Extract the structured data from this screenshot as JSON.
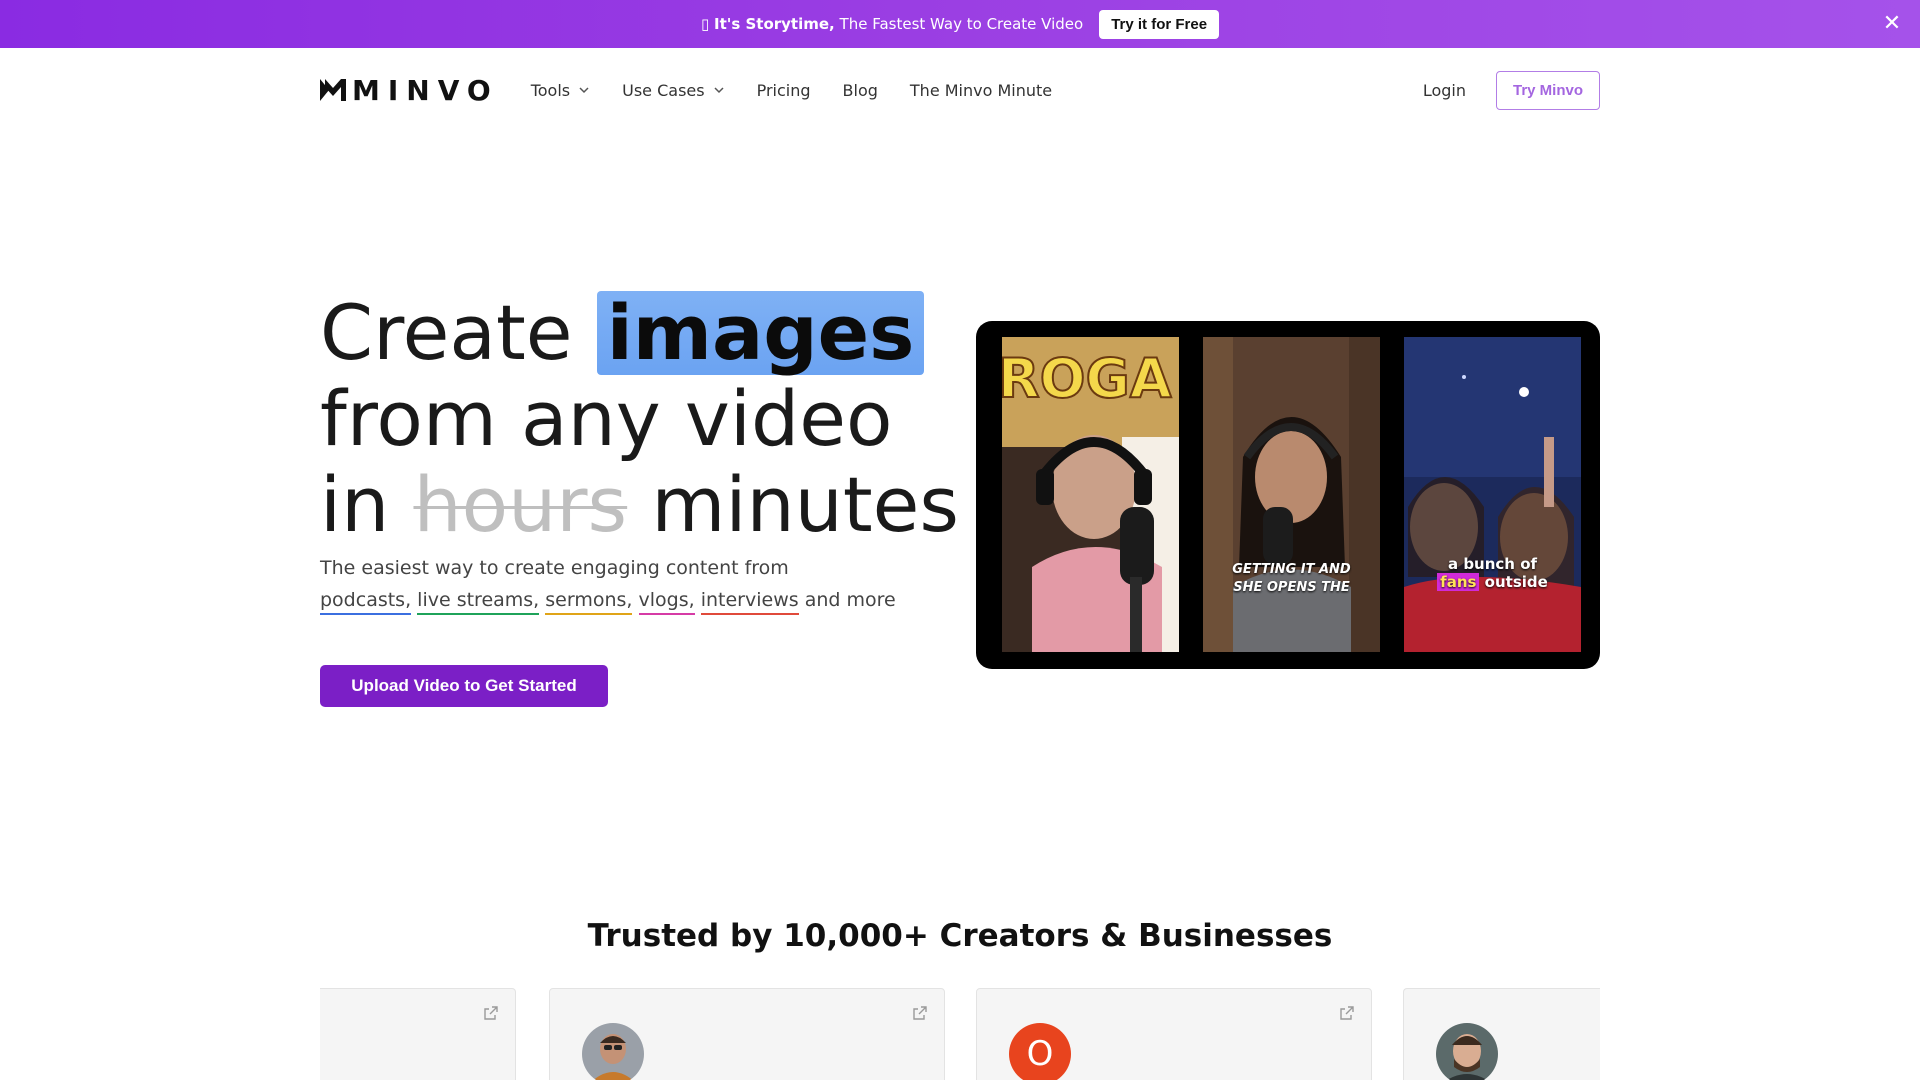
{
  "announcement": {
    "emoji": "▯",
    "bold": "It's Storytime,",
    "text": "The Fastest Way to Create Video",
    "cta": "Try it for Free",
    "close_icon": "close-icon"
  },
  "nav": {
    "logo_text": "MINVO",
    "items": [
      {
        "label": "Tools",
        "dropdown": true
      },
      {
        "label": "Use Cases",
        "dropdown": true
      },
      {
        "label": "Pricing",
        "dropdown": false
      },
      {
        "label": "Blog",
        "dropdown": false
      },
      {
        "label": "The Minvo Minute",
        "dropdown": false
      }
    ],
    "login": "Login",
    "try": "Try Minvo"
  },
  "hero": {
    "line1_prefix": "Create",
    "highlight": "images",
    "line2": "from any video",
    "line3_prefix": "in",
    "strikethrough": "hours",
    "line3_suffix": "minutes",
    "subtitle_line1": "The easiest way to create engaging content from",
    "tags": [
      {
        "label": "podcasts,",
        "color": "#3b6fe0"
      },
      {
        "label": "live streams,",
        "color": "#1fa35a"
      },
      {
        "label": "sermons,",
        "color": "#e0a418"
      },
      {
        "label": "vlogs,",
        "color": "#d63ba6"
      },
      {
        "label": "interviews",
        "color": "#e04a3b"
      }
    ],
    "subtitle_suffix": "and more",
    "cta": "Upload Video to Get Started"
  },
  "preview": {
    "frame1_sign": "ROGA",
    "frame2_caption_line1": "GETTING IT AND",
    "frame2_caption_line2": "SHE OPENS THE",
    "frame3_caption_line1": "a bunch of",
    "frame3_caption_mark": "fans",
    "frame3_caption_rest": "outside"
  },
  "trusted": {
    "title": "Trusted by 10,000+ Creators & Businesses",
    "cards": [
      {
        "avatar": "",
        "external_icon": "external-link-icon"
      },
      {
        "avatar": "photo",
        "external_icon": "external-link-icon"
      },
      {
        "avatar": "O",
        "external_icon": "external-link-icon"
      },
      {
        "avatar": "photo",
        "external_icon": ""
      }
    ]
  },
  "colors": {
    "brand_purple": "#7b1fc6",
    "banner_gradient_start": "#8a2be2",
    "highlight_blue": "#7fb1f5"
  }
}
